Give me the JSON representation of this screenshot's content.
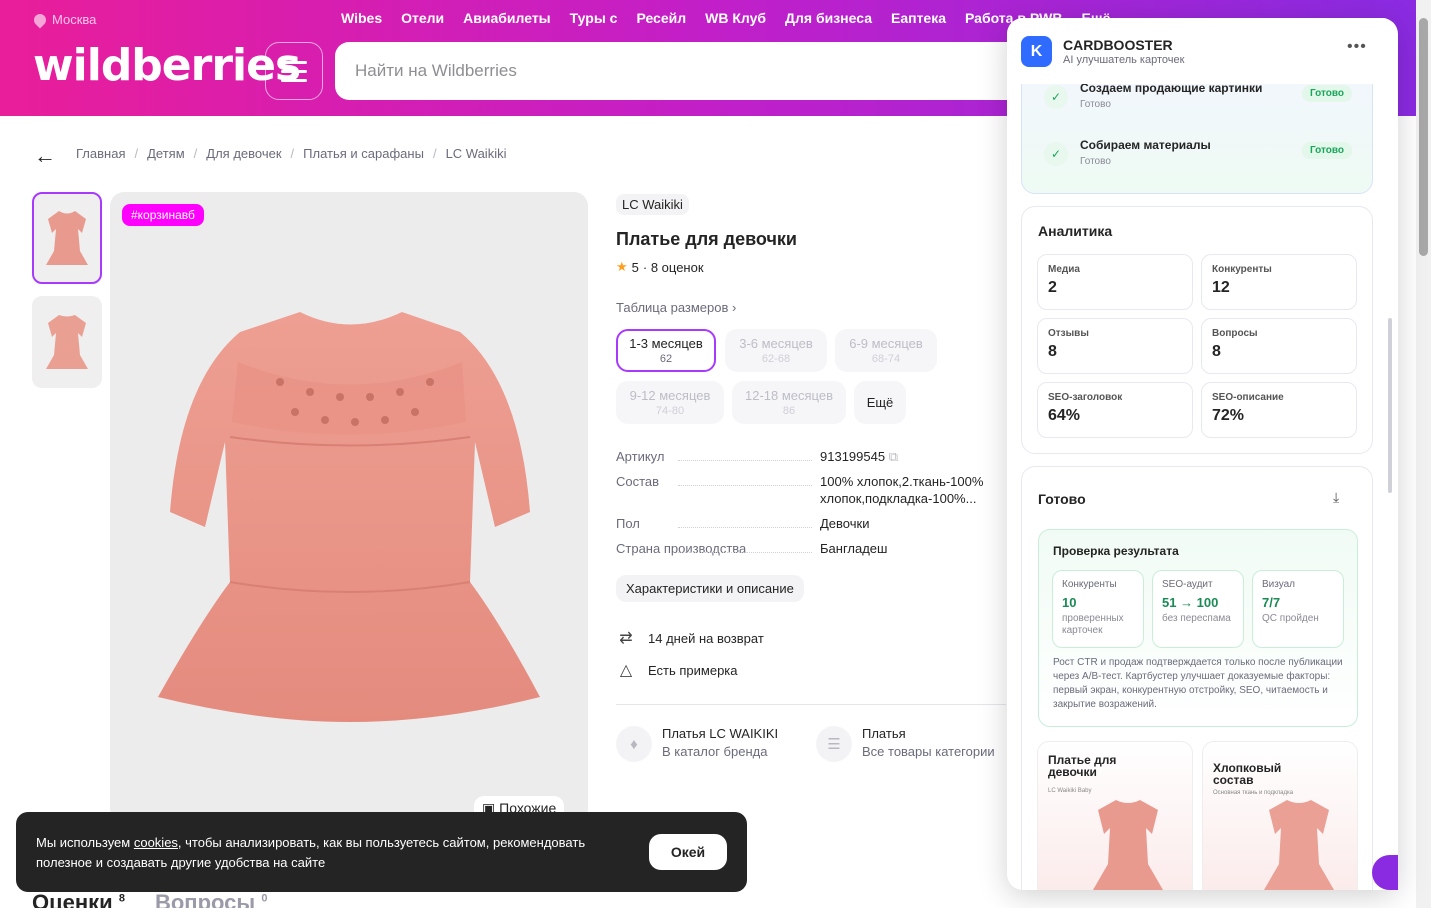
{
  "header": {
    "city": "Москва",
    "nav": [
      "Wibes",
      "Отели",
      "Авиабилеты",
      "Туры с",
      "Ресейл",
      "WB Клуб",
      "Для бизнеса",
      "Еаптека",
      "Работа в PWB",
      "Ещё"
    ],
    "logo": "wildberries",
    "search_placeholder": "Найти на Wildberries"
  },
  "breadcrumbs": [
    "Главная",
    "Детям",
    "Для девочек",
    "Платья и сарафаны",
    "LC Waikiki"
  ],
  "gallery": {
    "badge": "#корзинавб",
    "similar_label": "Похожие"
  },
  "product": {
    "brand": "LC Waikiki",
    "title": "Платье для девочки",
    "rating": "5",
    "reviews": "· 8 оценок",
    "size_table": "Таблица размеров",
    "sizes": [
      {
        "label": "1-3 месяцев",
        "sub": "62"
      },
      {
        "label": "3-6 месяцев",
        "sub": "62-68"
      },
      {
        "label": "6-9 месяцев",
        "sub": "68-74"
      },
      {
        "label": "9-12 месяцев",
        "sub": "74-80"
      },
      {
        "label": "12-18 месяцев",
        "sub": "86"
      }
    ],
    "more_sizes": "Ещё",
    "specs": [
      {
        "k": "Артикул",
        "v": "913199545"
      },
      {
        "k": "Состав",
        "v": "100% хлопок,2.ткань-100% хлопок,подкладка-100%..."
      },
      {
        "k": "Пол",
        "v": "Девочки"
      },
      {
        "k": "Страна производства",
        "v": "Бангладеш"
      }
    ],
    "details_chip": "Характеристики и описание",
    "features": [
      "14 дней на возврат",
      "Есть примерка"
    ],
    "categories": [
      {
        "t1": "Платья LC WAIKIKI",
        "t2": "В каталог бренда"
      },
      {
        "t1": "Платья",
        "t2": "Все товары категории"
      }
    ]
  },
  "cookie": {
    "text_before": "Мы используем ",
    "link": "cookies",
    "text_after": ", чтобы анализировать, как вы пользуетесь сайтом, рекомендовать полезное и создавать другие удобства на сайте",
    "ok": "Окей"
  },
  "bottom_tabs": [
    {
      "label": "Оценки",
      "count": "8"
    },
    {
      "label": "Вопросы",
      "count": "0"
    }
  ],
  "panel": {
    "logo_letter": "K",
    "name": "CARDBOOSTER",
    "subtitle": "AI улучшатель карточек",
    "steps": [
      {
        "title": "Создаем продающие картинки",
        "sub": "Готово",
        "status": "Готово"
      },
      {
        "title": "Собираем материалы",
        "sub": "Готово",
        "status": "Готово"
      }
    ],
    "analytics": {
      "title": "Аналитика",
      "metrics": [
        {
          "label": "Медиа",
          "value": "2"
        },
        {
          "label": "Конкуренты",
          "value": "12"
        },
        {
          "label": "Отзывы",
          "value": "8"
        },
        {
          "label": "Вопросы",
          "value": "8"
        },
        {
          "label": "SEO-заголовок",
          "value": "64%"
        },
        {
          "label": "SEO-описание",
          "value": "72%"
        }
      ]
    },
    "ready": {
      "title": "Готово",
      "verify_title": "Проверка результата",
      "boxes": [
        {
          "label": "Конкуренты",
          "value": "10",
          "desc": "проверенных карточек"
        },
        {
          "label": "SEO-аудит",
          "value": "51 → 100",
          "desc": "без переспама"
        },
        {
          "label": "Визуал",
          "value": "7/7",
          "desc": "QC пройден"
        }
      ],
      "note": "Рост CTR и продаж подтверждается только после публикации через A/B-тест. Картбустер улучшает доказуемые факторы: первый экран, конкурентную отстройку, SEO, читаемость и закрытие возражений.",
      "previews": [
        {
          "title": "Платье для девочки",
          "sub": "LC Waikiki Baby"
        },
        {
          "title": "Хлопковый состав",
          "sub": "Основная ткань и подкладка"
        }
      ]
    }
  }
}
